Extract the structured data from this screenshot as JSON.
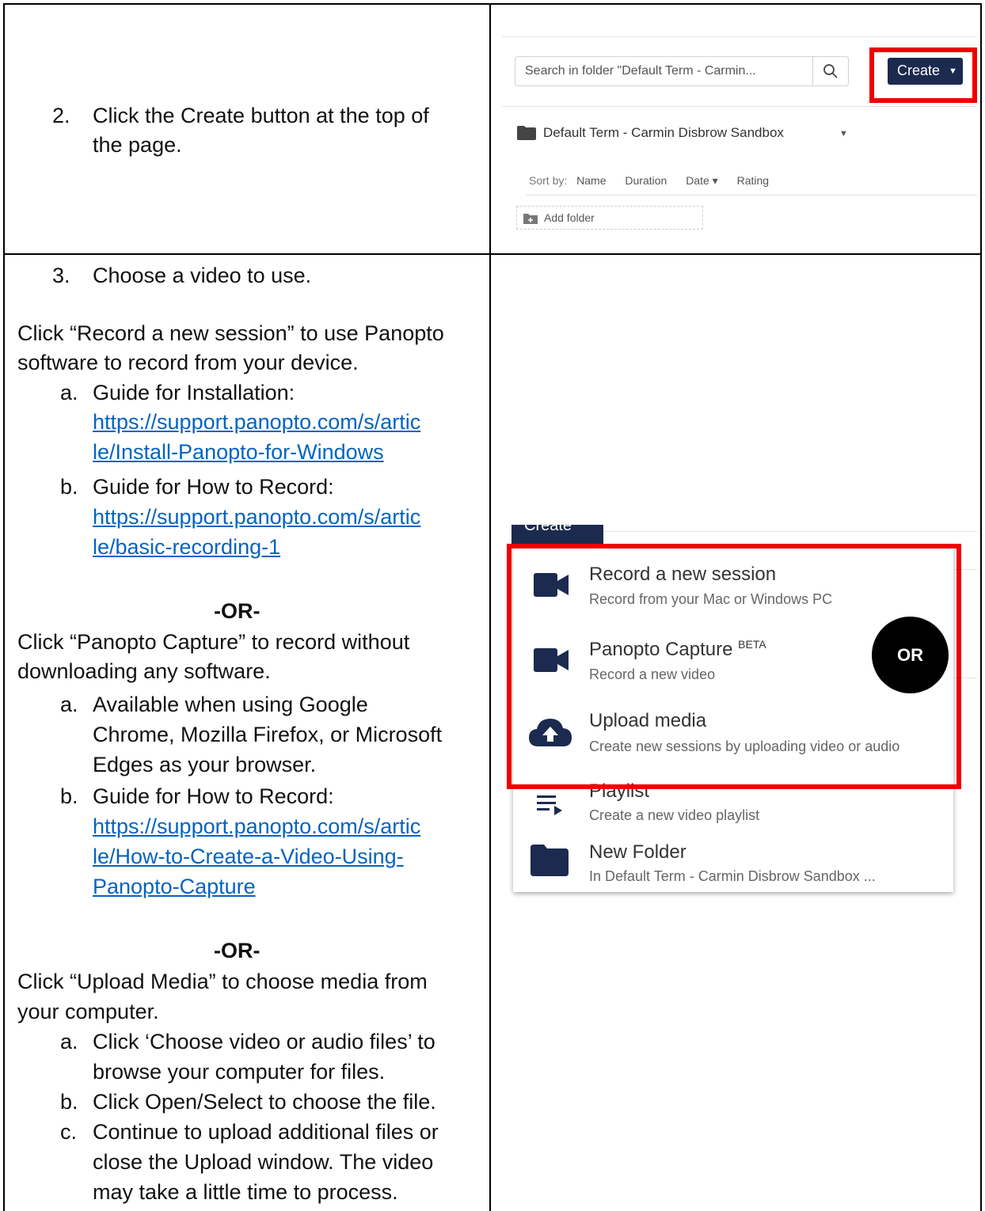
{
  "left": {
    "step2": [
      "2.",
      "Click the Create button at the top of",
      "the page."
    ],
    "step3": [
      "3.",
      "Choose a video to use."
    ],
    "record_intro": [
      "Click “Record a new session” to use Panopto",
      "software to record from your device."
    ],
    "record_items": [
      {
        "marker": "a.",
        "label": "Guide for Installation:",
        "link": [
          "https://support.panopto.com/s/artic",
          "le/Install-Panopto-for-Windows"
        ]
      },
      {
        "marker": "b.",
        "label": "Guide for How to Record:",
        "link": [
          "https://support.panopto.com/s/artic",
          "le/basic-recording-1"
        ]
      }
    ],
    "or1": "-OR-",
    "capture_intro": [
      "Click “Panopto Capture” to record without",
      "downloading any software."
    ],
    "capture_items": [
      {
        "marker": "a.",
        "lines": [
          "Available when using Google",
          "Chrome, Mozilla Firefox, or Microsoft",
          "Edges as your browser."
        ]
      },
      {
        "marker": "b.",
        "label": "Guide for How to Record:",
        "link": [
          "https://support.panopto.com/s/artic",
          "le/How-to-Create-a-Video-Using-",
          "Panopto-Capture"
        ]
      }
    ],
    "or2": "-OR-",
    "upload_intro": [
      "Click “Upload Media” to choose media from",
      "your computer."
    ],
    "upload_items": [
      {
        "marker": "a.",
        "lines": [
          "Click ‘Choose video or audio files’ to",
          "browse your computer for files."
        ]
      },
      {
        "marker": "b.",
        "lines": [
          "Click Open/Select to choose the file."
        ]
      },
      {
        "marker": "c.",
        "lines": [
          "Continue to upload additional files or",
          "close the Upload window. The video",
          "may take a little time to process."
        ]
      }
    ]
  },
  "shot1": {
    "search_placeholder": "Search in folder \"Default Term - Carmin...",
    "create_label": "Create",
    "folder_name": "Default Term - Carmin Disbrow Sandbox",
    "sort_label": "Sort by:",
    "sort_options": [
      "Name",
      "Duration",
      "Date ▾",
      "Rating"
    ],
    "add_folder": "Add folder"
  },
  "shot2": {
    "items": [
      {
        "title": "Record a new session",
        "sub": "Record from your Mac or Windows PC",
        "icon": "video-camera-icon"
      },
      {
        "title": "Panopto Capture",
        "sup": "BETA",
        "sub": "Record a new video",
        "icon": "video-camera-icon"
      },
      {
        "title": "Upload media",
        "sub": "Create new sessions by uploading video or audio",
        "icon": "cloud-upload-icon"
      },
      {
        "title": "Playlist",
        "sub": "Create a new video playlist",
        "icon": "playlist-icon"
      },
      {
        "title": "New Folder",
        "sub": "In Default Term - Carmin Disbrow Sandbox ...",
        "icon": "folder-icon"
      }
    ],
    "or_badge": "OR"
  },
  "colors": {
    "highlight": "#e00000",
    "navy": "#1b2a4e",
    "link": "#0563c1"
  }
}
